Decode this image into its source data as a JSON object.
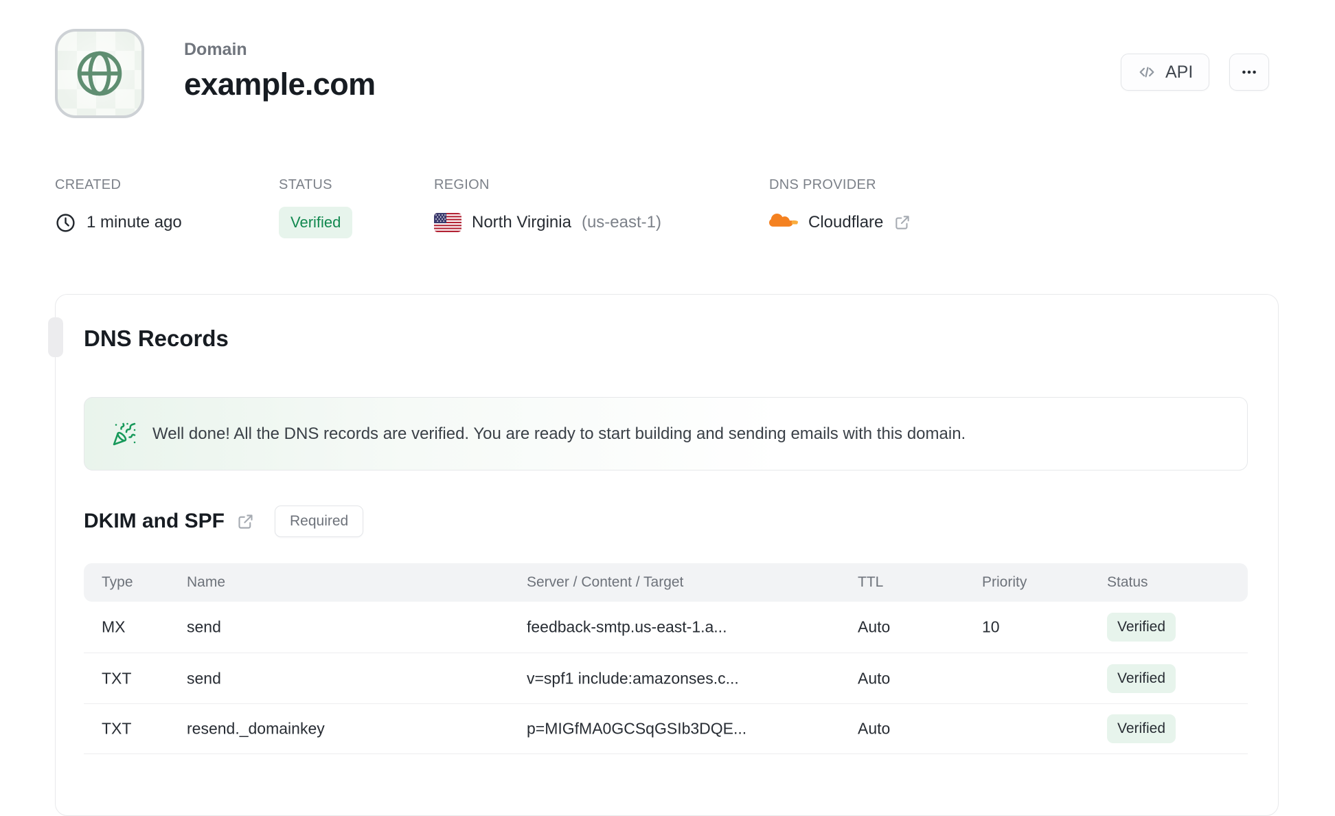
{
  "header": {
    "label": "Domain",
    "title": "example.com",
    "api_button_label": "API"
  },
  "meta": {
    "created": {
      "label": "CREATED",
      "value": "1 minute ago"
    },
    "status": {
      "label": "STATUS",
      "value": "Verified"
    },
    "region": {
      "label": "REGION",
      "name": "North Virginia",
      "code": "(us-east-1)"
    },
    "provider": {
      "label": "DNS PROVIDER",
      "value": "Cloudflare"
    }
  },
  "dns": {
    "title": "DNS Records",
    "banner": {
      "message": "Well done! All the DNS records are verified. You are ready to start building and sending emails with this domain."
    },
    "section": {
      "title": "DKIM and SPF",
      "badge": "Required"
    },
    "table": {
      "headers": [
        "Type",
        "Name",
        "Server / Content / Target",
        "TTL",
        "Priority",
        "Status"
      ],
      "rows": [
        {
          "type": "MX",
          "name": "send",
          "content": "feedback-smtp.us-east-1.a...",
          "ttl": "Auto",
          "priority": "10",
          "status": "Verified"
        },
        {
          "type": "TXT",
          "name": "send",
          "content": "v=spf1 include:amazonses.c...",
          "ttl": "Auto",
          "priority": "",
          "status": "Verified"
        },
        {
          "type": "TXT",
          "name": "resend._domainkey",
          "content": "p=MIGfMA0GCSqGSIb3DQE...",
          "ttl": "Auto",
          "priority": "",
          "status": "Verified"
        }
      ]
    }
  },
  "colors": {
    "accent_green_text": "#11884f",
    "accent_green_bg": "#e7f4ec",
    "banner_green": "#17995a",
    "globe_green": "#5f8e71",
    "cloudflare_orange": "#f48120",
    "cloudflare_orange_light": "#faad3f",
    "flag_red": "#b22234",
    "flag_blue": "#3c3b6e",
    "table_header_bg": "#f2f3f5",
    "border_gray": "#e8e9eb"
  },
  "icons": {
    "tile": "globe-icon",
    "api": "code-icon",
    "more": "ellipsis-icon",
    "created": "clock-icon",
    "region": "us-flag-icon",
    "provider": "cloudflare-icon",
    "external": "external-link-icon",
    "banner": "party-popper-icon"
  }
}
